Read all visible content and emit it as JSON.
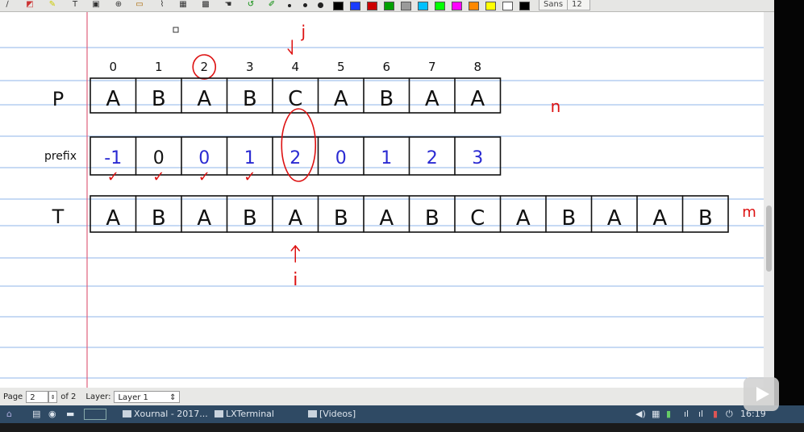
{
  "colors": {
    "ruling": "#8fb6e8",
    "margin": "#e0607d",
    "pen": "#111111",
    "blue": "#2a2ad2",
    "red": "#dd1111"
  },
  "toolbar": {
    "font_name": "Sans",
    "font_size": "12",
    "color_swatches": [
      "#000000",
      "#1a3cff",
      "#cc0000",
      "#00a000",
      "#9a9a9a",
      "#00c0ff",
      "#00ff00",
      "#ff00ff",
      "#ff8800",
      "#ffff00",
      "#ffffff",
      "#000000"
    ]
  },
  "diagram": {
    "indices": [
      "0",
      "1",
      "2",
      "3",
      "4",
      "5",
      "6",
      "7",
      "8"
    ],
    "pattern_label": "P",
    "pattern": [
      "A",
      "B",
      "A",
      "B",
      "C",
      "A",
      "B",
      "A",
      "A"
    ],
    "n_label": "n",
    "prefix_label": "prefix",
    "prefix": [
      "-1",
      "0",
      "0",
      "1",
      "2",
      "0",
      "1",
      "2",
      "3"
    ],
    "check_marks": [
      "✓",
      "✓",
      "✓",
      "✓"
    ],
    "text_label": "T",
    "text": [
      "A",
      "B",
      "A",
      "B",
      "A",
      "B",
      "A",
      "B",
      "C",
      "A",
      "B",
      "A",
      "A",
      "B"
    ],
    "m_label": "m",
    "j_label": "j",
    "i_label": "i"
  },
  "statusbar": {
    "page_label": "Page",
    "page_value": "2",
    "page_total": "of 2",
    "layer_label": "Layer:",
    "layer_value": "Layer 1"
  },
  "taskbar": {
    "tasks": [
      "Xournal - 2017...",
      "LXTerminal",
      "[Videos]"
    ],
    "clock": "16:19"
  }
}
